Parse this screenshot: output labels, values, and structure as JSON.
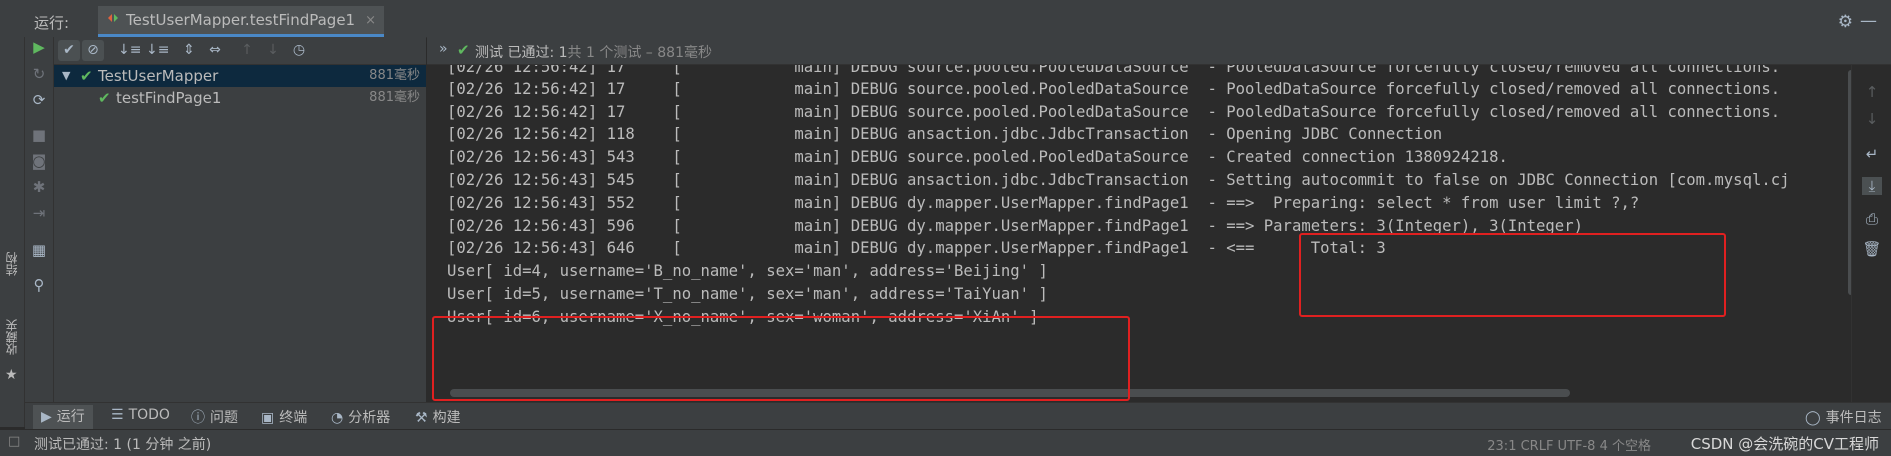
{
  "tab_bar": {
    "run_label": "运行:",
    "tab_title": "TestUserMapper.testFindPage1",
    "close_glyph": "×"
  },
  "left_rail": {
    "structure_label": "结构",
    "favorites_label": "收藏夹"
  },
  "tree": {
    "items": [
      {
        "name": "TestUserMapper",
        "time": "881毫秒",
        "status": "passed",
        "selected": true
      },
      {
        "name": "testFindPage1",
        "time": "881毫秒",
        "status": "passed",
        "selected": false
      }
    ]
  },
  "status_line": {
    "passed_text": "测试 已通过: ",
    "passed_count": "1",
    "summary": "共 1 个测试 – 881毫秒"
  },
  "console": {
    "lines": [
      "[02/26 12:56:42] 17     [            main] DEBUG source.pooled.PooledDataSource  - PooledDataSource forcefully closed/removed all connections.",
      "[02/26 12:56:42] 17     [            main] DEBUG source.pooled.PooledDataSource  - PooledDataSource forcefully closed/removed all connections.",
      "[02/26 12:56:42] 17     [            main] DEBUG source.pooled.PooledDataSource  - PooledDataSource forcefully closed/removed all connections.",
      "[02/26 12:56:42] 118    [            main] DEBUG ansaction.jdbc.JdbcTransaction  - Opening JDBC Connection",
      "[02/26 12:56:43] 543    [            main] DEBUG source.pooled.PooledDataSource  - Created connection 1380924218.",
      "[02/26 12:56:43] 545    [            main] DEBUG ansaction.jdbc.JdbcTransaction  - Setting autocommit to false on JDBC Connection [com.mysql.cj",
      "[02/26 12:56:43] 552    [            main] DEBUG dy.mapper.UserMapper.findPage1  - ==>  Preparing: select * from user limit ?,?",
      "[02/26 12:56:43] 596    [            main] DEBUG dy.mapper.UserMapper.findPage1  - ==> Parameters: 3(Integer), 3(Integer)",
      "[02/26 12:56:43] 646    [            main] DEBUG dy.mapper.UserMapper.findPage1  - <==      Total: 3",
      "User[ id=4, username='B_no_name', sex='man', address='Beijing' ]",
      "User[ id=5, username='T_no_name', sex='man', address='TaiYuan' ]",
      "User[ id=6, username='X_no_name', sex='woman', address='XiAn' ]"
    ]
  },
  "bottom_tools": {
    "run": "运行",
    "todo": "TODO",
    "problems": "问题",
    "terminal": "终端",
    "profiler": "分析器",
    "build": "构建",
    "event_log": "事件日志"
  },
  "status_bar": {
    "message": "测试已通过: 1 (1 分钟 之前)",
    "caret": "23:1  CRLF  UTF-8  4 个空格",
    "watermark": "CSDN @会洗碗的CV工程师"
  },
  "colors": {
    "accent_blue": "#4a88c7",
    "pass_green": "#5fb85f",
    "highlight_red": "#e02020",
    "console_bg": "#2b2b2b",
    "panel_bg": "#3c3f41"
  },
  "icons": {
    "run": "play-icon",
    "rerun": "rerun-icon",
    "stop": "stop-icon",
    "settings": "gear-icon"
  }
}
